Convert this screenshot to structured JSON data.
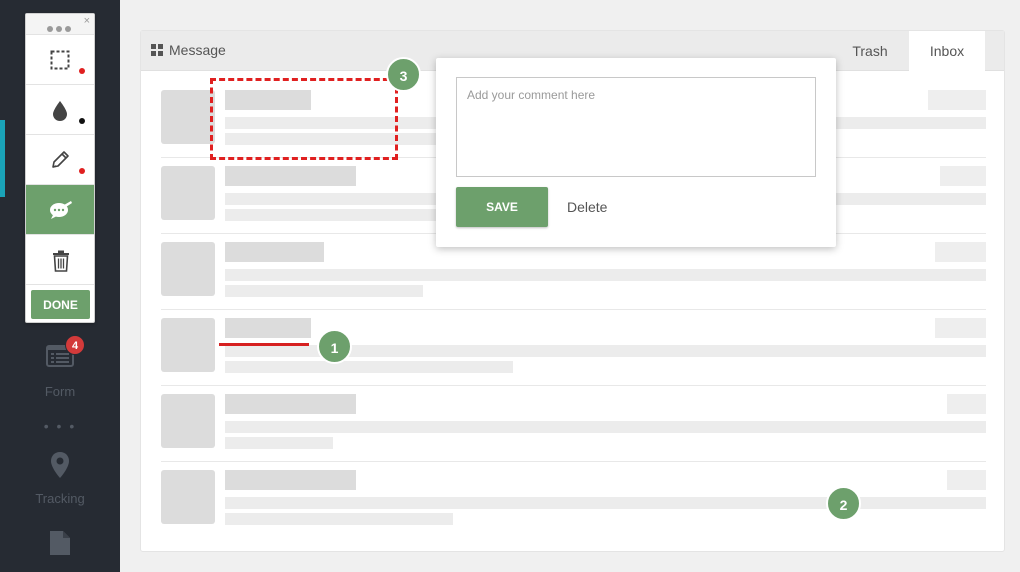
{
  "sidebar": {
    "badge_count": "4",
    "form_label": "Form",
    "dots": "• • •",
    "tracking_label": "Tracking"
  },
  "toolbar": {
    "tools": [
      "select-rectangle-icon",
      "color-drop-icon",
      "pencil-icon",
      "comment-bubble-icon",
      "trash-icon"
    ],
    "indicator_colors": [
      "#e02020",
      "#111111",
      "#e02020"
    ],
    "done_label": "DONE",
    "close_label": "×"
  },
  "panel": {
    "title": "Message",
    "tabs": [
      "Trash",
      "Inbox"
    ],
    "active_tab": "Inbox"
  },
  "popup": {
    "placeholder": "Add your comment here",
    "save_label": "SAVE",
    "delete_label": "Delete"
  },
  "markers": [
    "1",
    "2",
    "3"
  ],
  "colors": {
    "accent_green": "#6da06c",
    "annotation_red": "#e02020",
    "sidebar_bg": "#262b33",
    "badge_red": "#d33a3a"
  }
}
